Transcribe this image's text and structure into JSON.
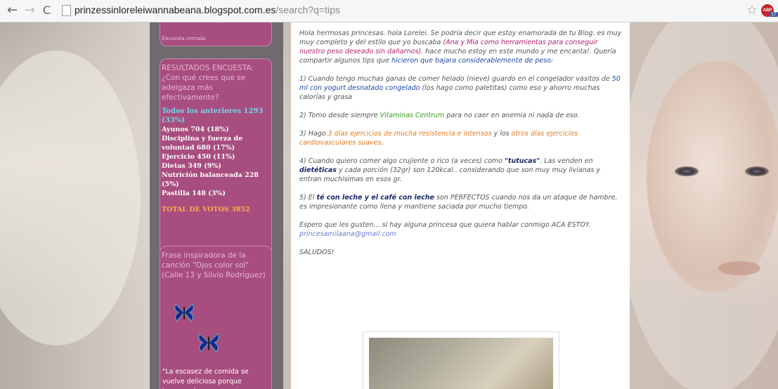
{
  "browser": {
    "back": "←",
    "forward": "→",
    "reload": "C",
    "url_domain": "prinzessinloreleiwannabeana.blogspot.com.es",
    "url_rest": "/search?q=tips",
    "bookmark_star": "☆",
    "abp_label": "ABP",
    "abp_count": "17"
  },
  "sidebar": {
    "top_widget_note": "Encuesta cerrada",
    "results_title": "RESULTADOS ENCUESTA: ¿Con qué crees que se adelgaza más efectivamente?",
    "results": [
      "Todos los anteriores 1293 (33%)",
      "Ayunos 704 (18%)",
      "Disciplina y fuerza de voluntad 680 (17%)",
      "Ejercicio 450 (11%)",
      "Dietas 349 (9%)",
      "Nutrición balanceada 228 (5%)",
      "Pastilla 148 (3%)"
    ],
    "total": "TOTAL DE VOTOS 3852",
    "frase_title": "Frase inspiradora de la canción \"Ojos color sol\" (Calle 13 y Silvio Rodríguez)",
    "quote": "\"La escasez de comida se vuelve deliciosa porque tenemos la"
  },
  "post": {
    "p1_a": "Hola hermosas princesas. hola Lorelei. Se podría decir que estoy enamorada de tu Blog. es muy muy completo y del estilo que yo buscaba ",
    "p1_b": "(Ana y Mia como herramientas para conseguir nuestro peso deseado sin dañarnos)",
    "p1_c": ". hace mucho estoy en este mundo y me encanta!. Quería compartir algunos tips que ",
    "p1_d": "hicieron que bajara considerablemente de peso",
    "p1_e": ":",
    "p2_a": "1) Cuando tengo muchas ganas de comer helado (nieve) guardo en el congelador vasitos de ",
    "p2_b": "50 ml con yogurt desnatado congelado",
    "p2_c": " (los hago como paletitas) como eso y ahorro muchas calorías y grasa",
    "p3_a": "2) Tomo desde siempre ",
    "p3_b": "Vitaminas Centrum",
    "p3_c": " para no caer en anemia ni nada de eso.",
    "p4_a": "3) Hago ",
    "p4_b": "3 días ejercicios de mucha resistencia e intensos",
    "p4_c": " y los ",
    "p4_d": "otros días ejercicios cardiovasculares suaves",
    "p4_e": ".",
    "p5_a": "4) Cuando quiero comer algo crujiente o rico (a veces) como ",
    "p5_b": "\"tutucas\"",
    "p5_c": ". Las venden en ",
    "p5_d": "dietéticas",
    "p5_e": " y cada porción (32gr) son 120kcal.. considerando que son muy muy livianas y entran muchísimas en esos gr.",
    "p6_a": "5) El ",
    "p6_b": "té con leche y el café con leche",
    "p6_c": " son PERFECTOS cuando nos da un ataque de hambre. es impresionante como llena y mantiene saciada por mucho tiempo.",
    "p7": "Espero que les gusten... si hay alguna princesa que quiera hablar conmigo ACA ESTOY.",
    "email": "princesamilaana@gmail.com",
    "saludos": "SALUDOS!"
  },
  "colors": {
    "sidebar_bg": "#6f6a6e",
    "widget_bg": "#a84d7f",
    "highlight_magenta": "#b0226e",
    "highlight_blue": "#1d4aa0",
    "highlight_green": "#3a9a22",
    "highlight_orange": "#e07a1c"
  },
  "icons": {
    "page": "page-icon",
    "star": "star-icon",
    "abp": "adblock-icon",
    "butterfly": "butterfly-icon"
  }
}
